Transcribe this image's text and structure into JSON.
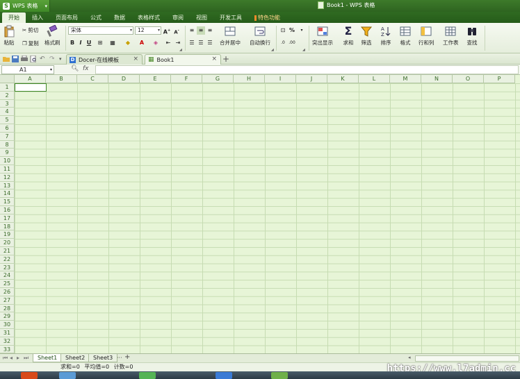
{
  "app": {
    "menu_label": "WPS 表格",
    "logo_letter": "S",
    "window_title": "Book1 - WPS 表格"
  },
  "ribbon_tabs": [
    {
      "label": "开始",
      "active": true
    },
    {
      "label": "插入"
    },
    {
      "label": "页面布局"
    },
    {
      "label": "公式"
    },
    {
      "label": "数据"
    },
    {
      "label": "表格样式"
    },
    {
      "label": "审阅"
    },
    {
      "label": "视图"
    },
    {
      "label": "开发工具"
    },
    {
      "label": "特色功能",
      "special": true
    }
  ],
  "ribbon": {
    "paste": "粘贴",
    "cut": "剪切",
    "copy": "复制",
    "format_painter": "格式刷",
    "font_name": "宋体",
    "font_size": "12",
    "bold": "B",
    "italic": "I",
    "underline": "U",
    "merge_center": "合并居中",
    "wrap_text": "自动换行",
    "percent": "%",
    "conditional": "突出显示",
    "sum": "求和",
    "filter": "筛选",
    "sort": "排序",
    "format": "格式",
    "row_col": "行和列",
    "worksheet": "工作表",
    "find": "查找"
  },
  "doc_tabs": [
    {
      "label": "Docer-在线模板",
      "active": false
    },
    {
      "label": "Book1",
      "active": true
    }
  ],
  "formula_bar": {
    "cell_ref": "A1",
    "fx": "fx",
    "value": ""
  },
  "columns": [
    "A",
    "B",
    "C",
    "D",
    "E",
    "F",
    "G",
    "H",
    "I",
    "J",
    "K",
    "L",
    "M",
    "N",
    "O",
    "P"
  ],
  "rows": [
    "1",
    "2",
    "3",
    "4",
    "5",
    "6",
    "7",
    "8",
    "9",
    "10",
    "11",
    "12",
    "13",
    "14",
    "15",
    "16",
    "17",
    "18",
    "19",
    "20",
    "21",
    "22",
    "23",
    "24",
    "25",
    "26",
    "27",
    "28",
    "29",
    "30",
    "31",
    "32",
    "33"
  ],
  "sheets": [
    {
      "label": "Sheet1",
      "active": true
    },
    {
      "label": "Sheet2"
    },
    {
      "label": "Sheet3"
    }
  ],
  "sheet_more": "···",
  "sheet_add": "+",
  "status": {
    "sum": "求和=0",
    "average": "平均值=0",
    "count": "计数=0"
  },
  "watermark": "https://www.l7admin.cc",
  "colors": {
    "accent": "#3f8827",
    "grid_bg": "#e7f5d7",
    "titlebar": "#2e6420"
  }
}
